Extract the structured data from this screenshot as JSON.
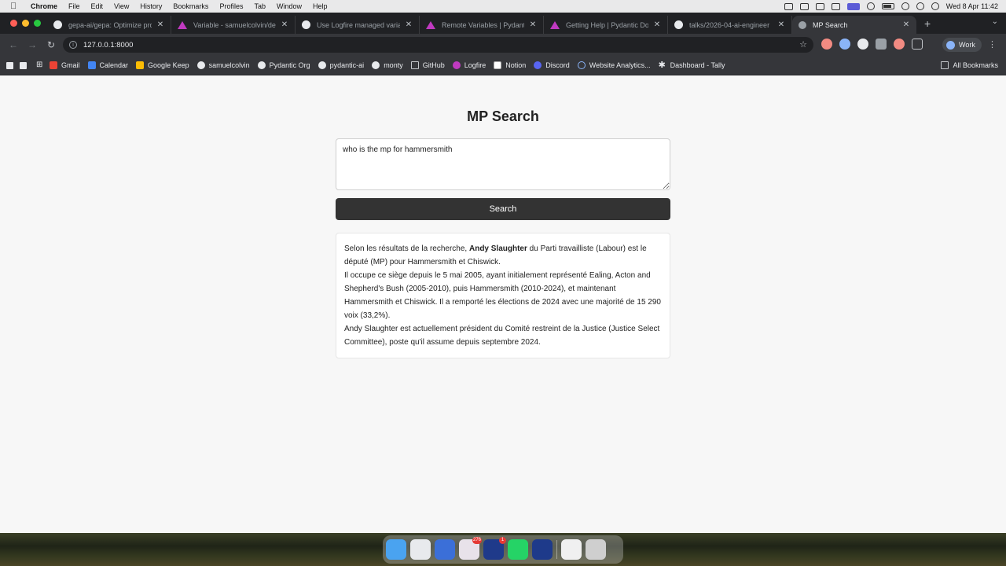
{
  "menubar": {
    "app_name": "Chrome",
    "items": [
      "File",
      "Edit",
      "View",
      "History",
      "Bookmarks",
      "Profiles",
      "Tab",
      "Window",
      "Help"
    ],
    "clock": "Wed 8 Apr  11:42"
  },
  "tabs": [
    {
      "title": "gepa-ai/gepa: Optimize prom",
      "icon": "github-icon"
    },
    {
      "title": "Variable - samuelcolvin/dem",
      "icon": "logfire-icon"
    },
    {
      "title": "Use Logfire managed variab",
      "icon": "github-icon"
    },
    {
      "title": "Remote Variables | Pydantic",
      "icon": "logfire-icon"
    },
    {
      "title": "Getting Help | Pydantic Docs",
      "icon": "logfire-icon"
    },
    {
      "title": "talks/2026-04-ai-engineer",
      "icon": "github-icon"
    },
    {
      "title": "MP Search",
      "icon": "globe-icon",
      "active": true
    }
  ],
  "toolbar": {
    "url": "127.0.0.1:8000",
    "profile_label": "Work"
  },
  "bookmarks": [
    {
      "label": "Gmail",
      "icon": "gmail"
    },
    {
      "label": "Calendar",
      "icon": "cal"
    },
    {
      "label": "Google Keep",
      "icon": "keep"
    },
    {
      "label": "samuelcolvin",
      "icon": "gh"
    },
    {
      "label": "Pydantic Org",
      "icon": "gh"
    },
    {
      "label": "pydantic-ai",
      "icon": "gh"
    },
    {
      "label": "monty",
      "icon": "gh"
    },
    {
      "label": "GitHub",
      "icon": "folder"
    },
    {
      "label": "Logfire",
      "icon": "lf"
    },
    {
      "label": "Notion",
      "icon": "notion"
    },
    {
      "label": "Discord",
      "icon": "discord"
    },
    {
      "label": "Website Analytics...",
      "icon": "wa"
    },
    {
      "label": "Dashboard - Tally",
      "icon": "tally"
    }
  ],
  "all_bookmarks_label": "All Bookmarks",
  "app": {
    "title": "MP Search",
    "query": "who is the mp for hammersmith",
    "search_label": "Search",
    "result": {
      "p1_before": "Selon les résultats de la recherche, ",
      "p1_bold": "Andy Slaughter",
      "p1_after": " du Parti travailliste (Labour) est le député (MP) pour Hammersmith et Chiswick.",
      "p2": "Il occupe ce siège depuis le 5 mai 2005, ayant initialement représenté Ealing, Acton and Shepherd's Bush (2005-2010), puis Hammersmith (2010-2024), et maintenant Hammersmith et Chiswick. Il a remporté les élections de 2024 avec une majorité de 15 290 voix (33,2%).",
      "p3": "Andy Slaughter est actuellement président du Comité restreint de la Justice (Justice Select Committee), poste qu'il assume depuis septembre 2024."
    }
  },
  "dock": [
    {
      "name": "finder",
      "color": "#4aa3f0"
    },
    {
      "name": "chrome",
      "color": "#e8eaed"
    },
    {
      "name": "textedit",
      "color": "#3b6fd8"
    },
    {
      "name": "slack",
      "color": "#e8e2ea",
      "badge": "276"
    },
    {
      "name": "app-dark",
      "color": "#1f3a8a",
      "badge": "1"
    },
    {
      "name": "whatsapp",
      "color": "#25d366"
    },
    {
      "name": "app-blue",
      "color": "#1e3a8a"
    },
    {
      "name": "downloads",
      "color": "#f0f0f0"
    },
    {
      "name": "trash",
      "color": "#cfcfcf"
    }
  ]
}
